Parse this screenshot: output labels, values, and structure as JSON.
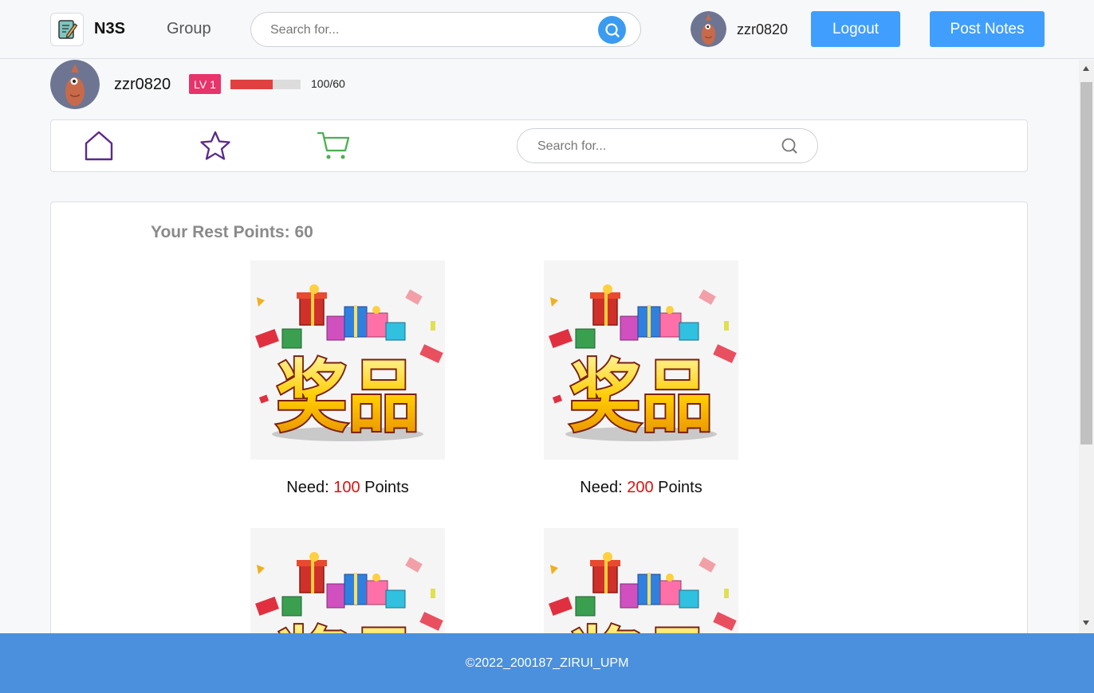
{
  "header": {
    "brand": "N3S",
    "nav_group": "Group",
    "search_placeholder": "Search for...",
    "username": "zzr0820",
    "logout_label": "Logout",
    "post_notes_label": "Post Notes"
  },
  "profile": {
    "username": "zzr0820",
    "level": "LV 1",
    "exp_text": "100/60",
    "exp_fill_fraction": 0.6
  },
  "subnav": {
    "icons": [
      "home-icon",
      "star-icon",
      "cart-icon"
    ],
    "search_placeholder": "Search for..."
  },
  "shop": {
    "rest_points": "Your Rest Points: 60",
    "need_prefix": "Need:",
    "points_suffix": "Points",
    "prizes": [
      {
        "points": "100",
        "image_text": "奖品"
      },
      {
        "points": "200",
        "image_text": "奖品"
      },
      {
        "points": "",
        "image_text": "奖品"
      },
      {
        "points": "",
        "image_text": "奖品"
      }
    ]
  },
  "footer": {
    "text": "©2022_200187_ZIRUI_UPM"
  },
  "colors": {
    "primary_blue": "#409eff",
    "footer_blue": "#4a90dd",
    "level_badge": "#e8336b",
    "exp_fill": "#e04040",
    "points_red": "#e01010"
  }
}
